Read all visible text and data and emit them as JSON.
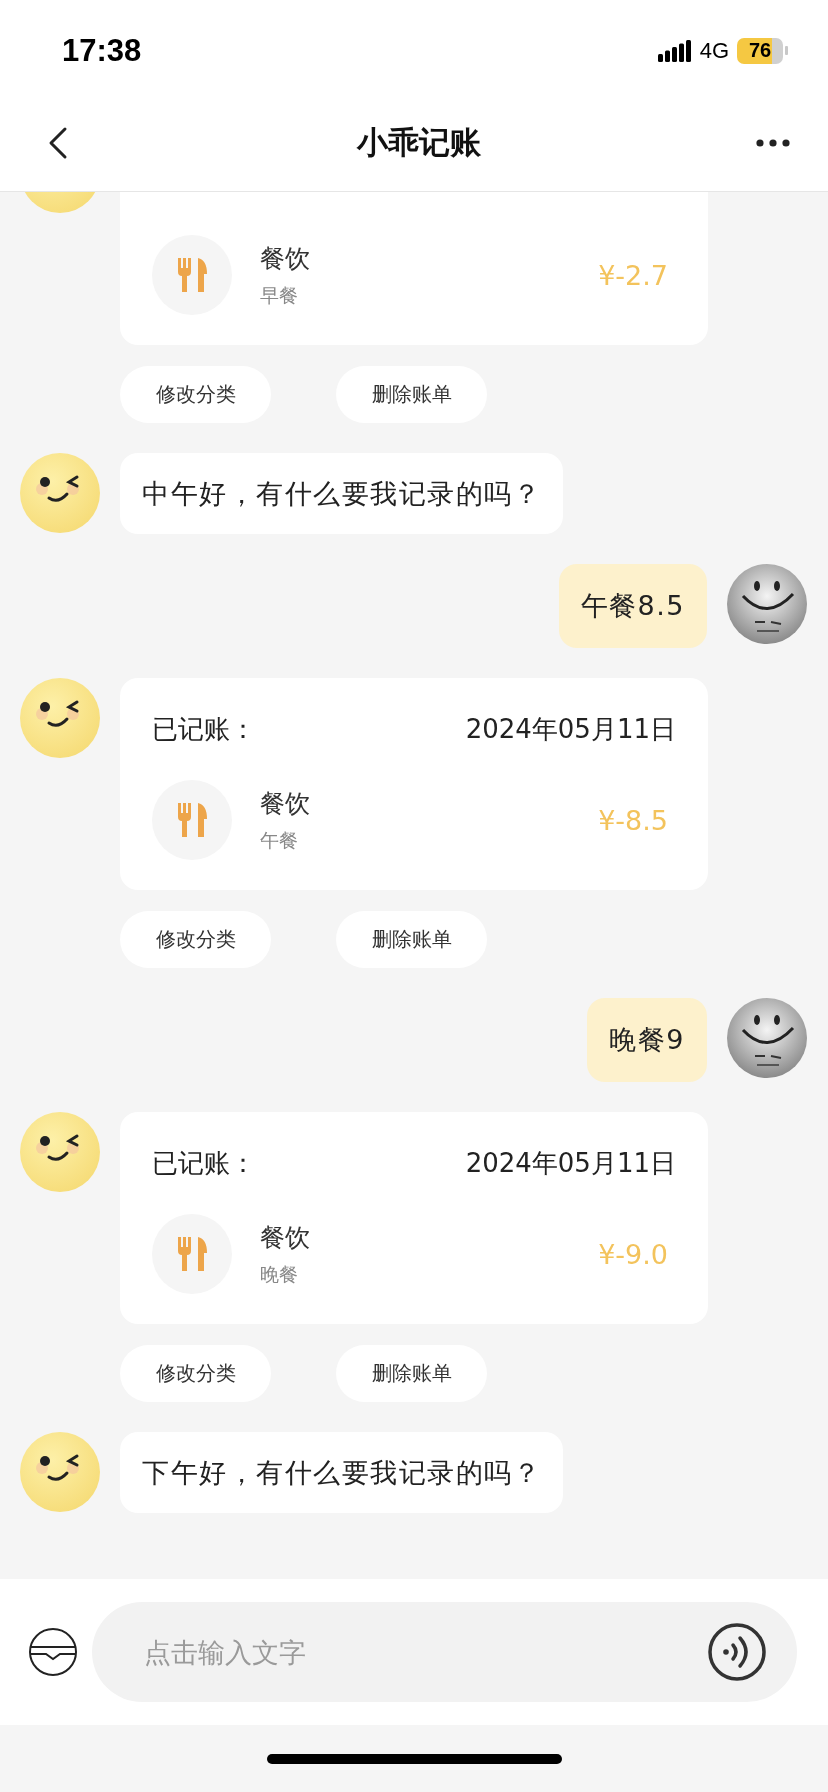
{
  "status_bar": {
    "time": "17:38",
    "network": "4G",
    "battery": "76"
  },
  "nav": {
    "title": "小乖记账"
  },
  "messages": [
    {
      "kind": "record",
      "category": "餐饮",
      "note": "早餐",
      "amount": "¥-2.7",
      "actions": [
        "修改分类",
        "删除账单"
      ]
    },
    {
      "kind": "bot_text",
      "text": "中午好，有什么要我记录的吗？"
    },
    {
      "kind": "user_text",
      "text": "午餐8.5"
    },
    {
      "kind": "record",
      "label": "已记账：",
      "date": "2024年05月11日",
      "category": "餐饮",
      "note": "午餐",
      "amount": "¥-8.5",
      "actions": [
        "修改分类",
        "删除账单"
      ]
    },
    {
      "kind": "user_text",
      "text": "晚餐9"
    },
    {
      "kind": "record",
      "label": "已记账：",
      "date": "2024年05月11日",
      "category": "餐饮",
      "note": "晚餐",
      "amount": "¥-9.0",
      "actions": [
        "修改分类",
        "删除账单"
      ]
    },
    {
      "kind": "bot_text",
      "text": "下午好，有什么要我记录的吗？"
    }
  ],
  "input": {
    "placeholder": "点击输入文字"
  }
}
